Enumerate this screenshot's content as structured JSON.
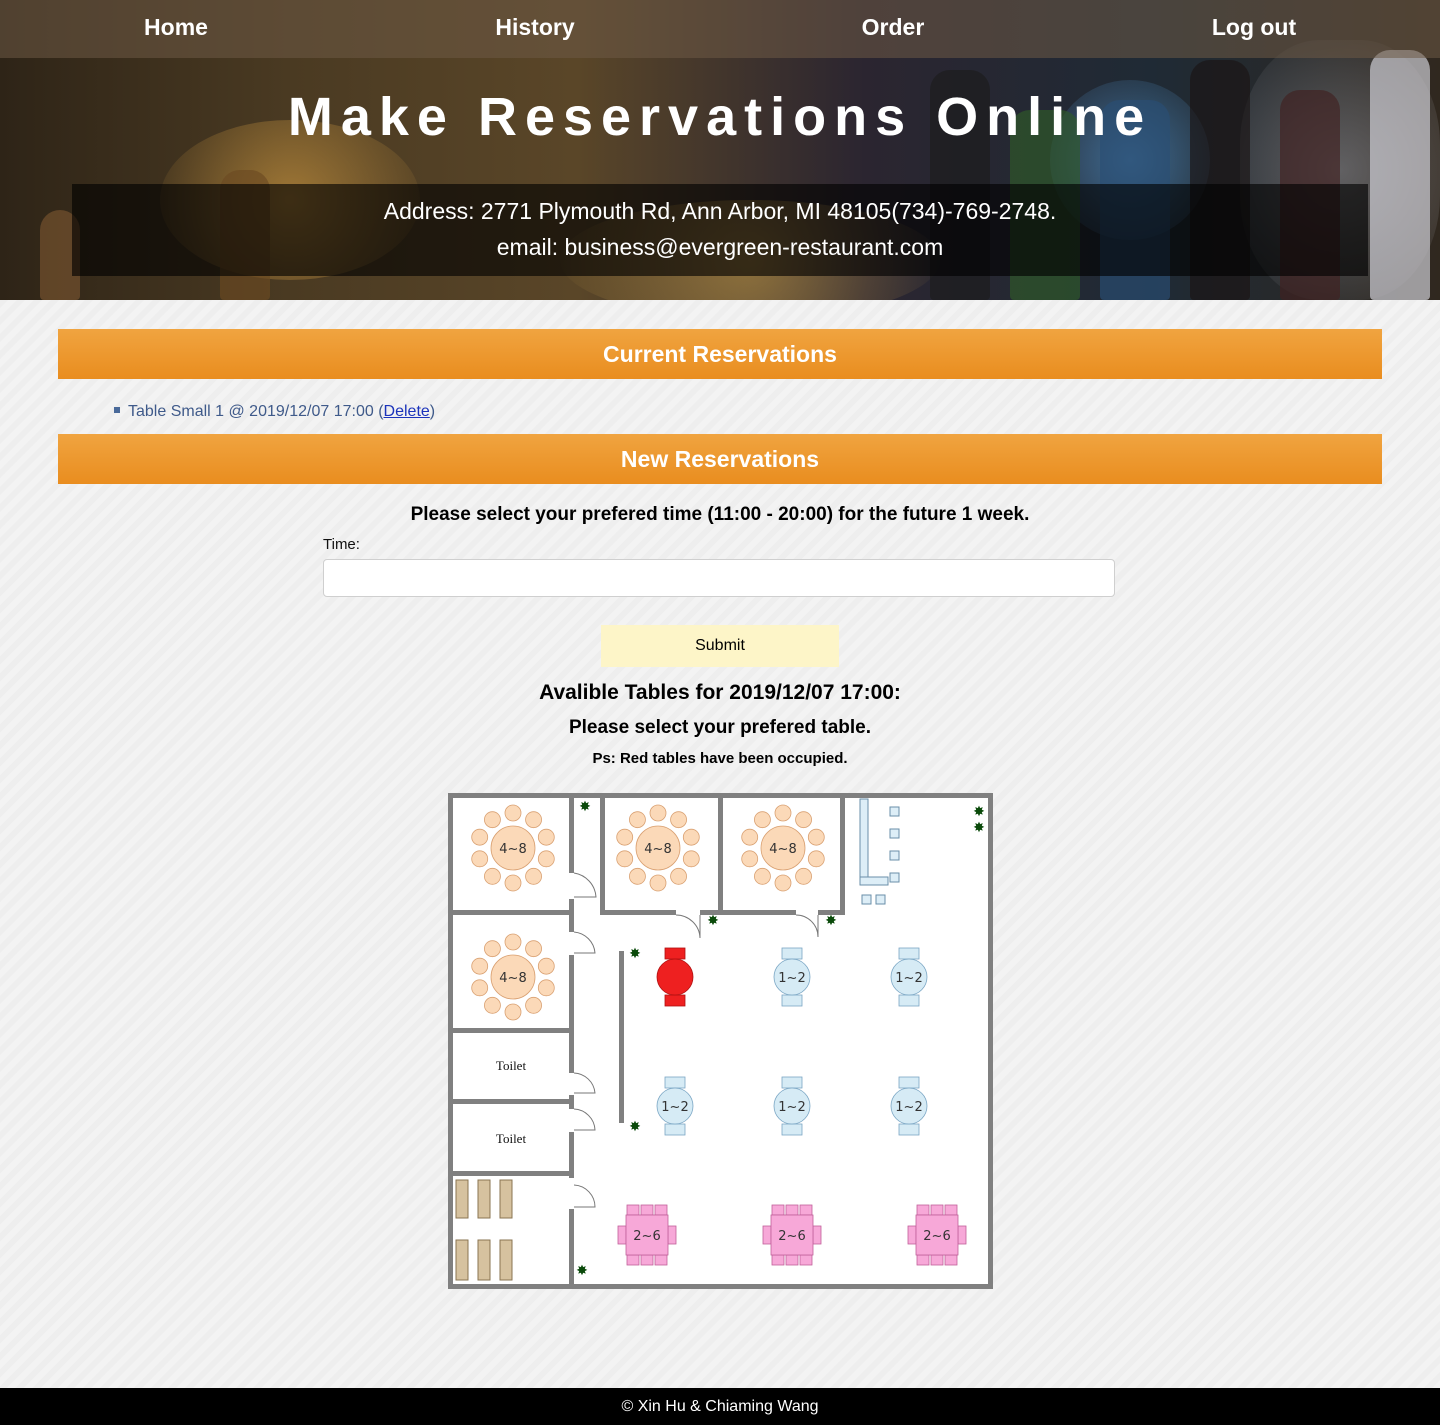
{
  "nav": {
    "items": [
      {
        "label": "Home"
      },
      {
        "label": "History"
      },
      {
        "label": "Order"
      },
      {
        "label": "Log out"
      }
    ]
  },
  "hero": {
    "title": "Make Reservations Online",
    "address": "Address: 2771 Plymouth Rd, Ann Arbor, MI 48105(734)-769-2748.",
    "email": "email: business@evergreen-restaurant.com"
  },
  "current": {
    "heading": "Current Reservations",
    "items": [
      {
        "text": "Table Small 1 @ 2019/12/07 17:00",
        "open_paren": "(",
        "delete_label": "Delete",
        "close_paren": ")"
      }
    ]
  },
  "new_reservation": {
    "heading": "New Reservations",
    "instruction": "Please select your prefered time (11:00 - 20:00) for the future 1 week.",
    "time_label": "Time:",
    "time_value": "",
    "submit_label": "Submit",
    "available_heading": "Avalible Tables for 2019/12/07 17:00:",
    "select_prompt": "Please select your prefered table.",
    "note": "Ps: Red tables have been occupied."
  },
  "floor_plan": {
    "large_tables": [
      {
        "label": "4~8",
        "status": "available"
      },
      {
        "label": "4~8",
        "status": "available"
      },
      {
        "label": "4~8",
        "status": "available"
      },
      {
        "label": "4~8",
        "status": "available"
      }
    ],
    "small_tables": [
      {
        "label": "",
        "status": "occupied"
      },
      {
        "label": "1~2",
        "status": "available"
      },
      {
        "label": "1~2",
        "status": "available"
      },
      {
        "label": "1~2",
        "status": "available"
      },
      {
        "label": "1~2",
        "status": "available"
      },
      {
        "label": "1~2",
        "status": "available"
      }
    ],
    "medium_tables": [
      {
        "label": "2~6",
        "status": "available"
      },
      {
        "label": "2~6",
        "status": "available"
      },
      {
        "label": "2~6",
        "status": "available"
      }
    ],
    "toilets": [
      {
        "label": "Toilet"
      },
      {
        "label": "Toilet"
      }
    ],
    "colors": {
      "large": "#fbd9b8",
      "small": "#d6ebf5",
      "medium": "#f7a8d8",
      "occupied": "#ee2020",
      "wall": "#808080"
    }
  },
  "footer": {
    "text": "© Xin Hu & Chiaming Wang"
  }
}
